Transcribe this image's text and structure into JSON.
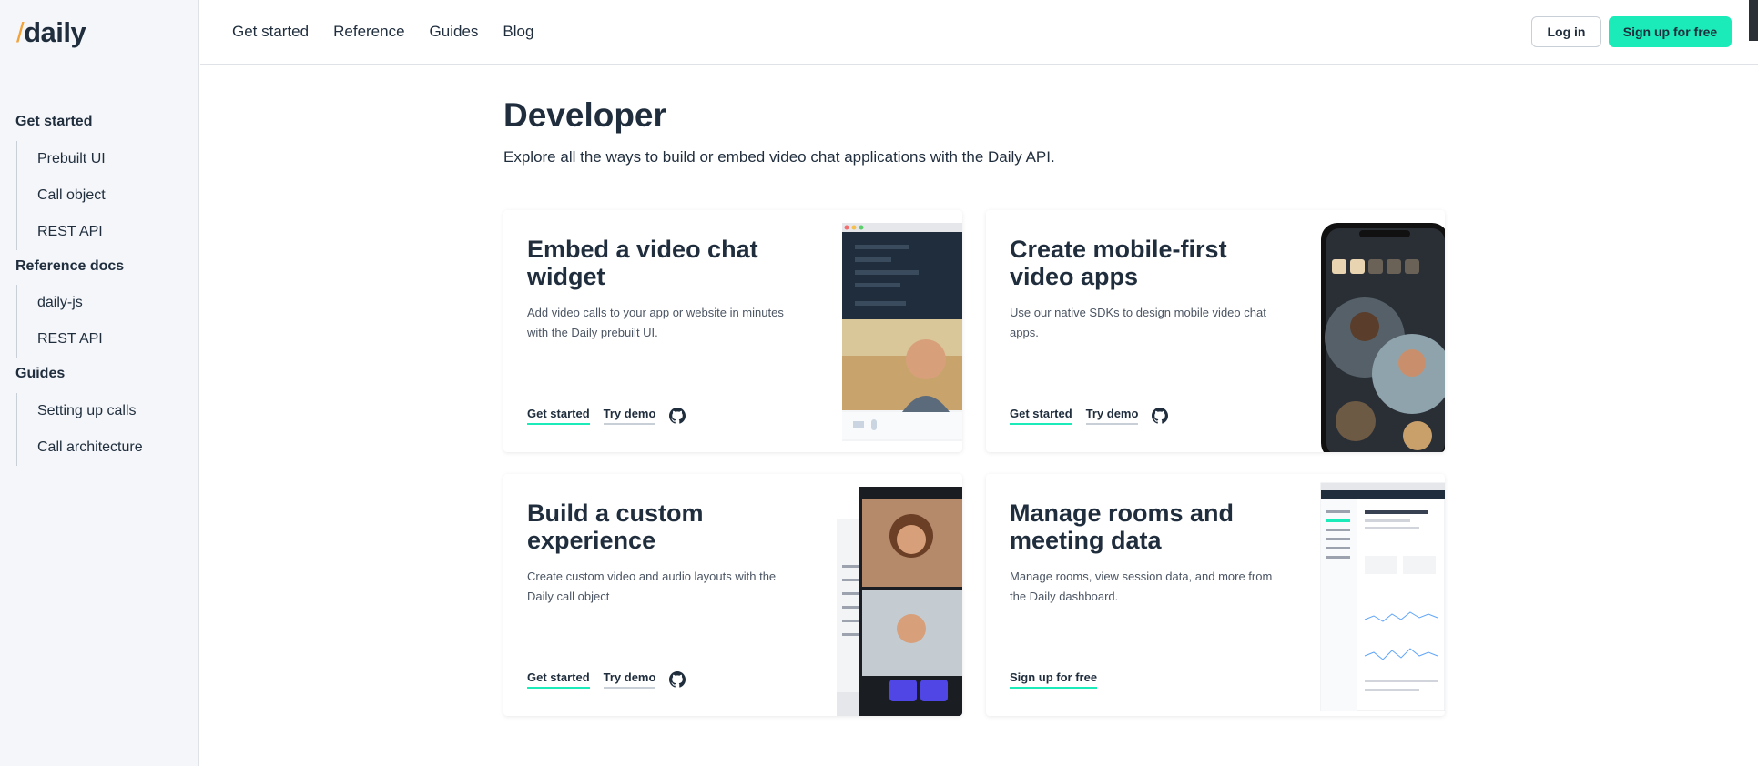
{
  "logo": {
    "slash": "/",
    "text": "daily"
  },
  "sidebar": {
    "sections": [
      {
        "title": "Get started",
        "items": [
          "Prebuilt UI",
          "Call object",
          "REST API"
        ]
      },
      {
        "title": "Reference docs",
        "items": [
          "daily-js",
          "REST API"
        ]
      },
      {
        "title": "Guides",
        "items": [
          "Setting up calls",
          "Call architecture"
        ]
      }
    ]
  },
  "topnav": {
    "items": [
      "Get started",
      "Reference",
      "Guides",
      "Blog"
    ],
    "login": "Log in",
    "signup": "Sign up for free"
  },
  "page": {
    "title": "Developer",
    "subtitle": "Explore all the ways to build or embed video chat applications with the Daily API."
  },
  "cards": [
    {
      "title": "Embed a video chat widget",
      "desc": "Add video calls to your app or website in minutes with the Daily prebuilt UI.",
      "links": [
        "Get started",
        "Try demo"
      ]
    },
    {
      "title": "Create mobile-first video apps",
      "desc": "Use our native SDKs to design mobile video chat apps.",
      "links": [
        "Get started",
        "Try demo"
      ]
    },
    {
      "title": "Build a custom experience",
      "desc": "Create custom video and audio layouts with the Daily call object",
      "links": [
        "Get started",
        "Try demo"
      ]
    },
    {
      "title": "Manage rooms and meeting data",
      "desc": "Manage rooms, view session data, and more from the Daily dashboard.",
      "links": [
        "Sign up for free"
      ]
    }
  ],
  "colors": {
    "accent": "#1bebb9",
    "text": "#1f2d3d",
    "logo_slash": "#f2a33a"
  },
  "icons": [
    "github-icon"
  ]
}
